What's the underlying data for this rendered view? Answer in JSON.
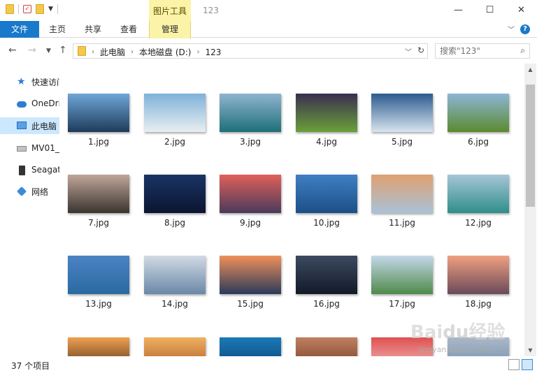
{
  "window": {
    "title": "123",
    "contextual_tab_group": "图片工具",
    "minimize_icon": "minimize-icon",
    "maximize_icon": "maximize-icon",
    "close_icon": "close-icon"
  },
  "ribbon": {
    "tabs": [
      "文件",
      "主页",
      "共享",
      "查看",
      "管理"
    ]
  },
  "address": {
    "crumbs": [
      "此电脑",
      "本地磁盘 (D:)",
      "123"
    ]
  },
  "search": {
    "placeholder": "搜索\"123\""
  },
  "nav": {
    "items": [
      {
        "label": "快速访问",
        "icon": "star-icon"
      },
      {
        "label": "OneDrive",
        "icon": "onedrive-icon"
      },
      {
        "label": "此电脑",
        "icon": "this-pc-icon",
        "selected": true
      },
      {
        "label": "MV01_",
        "icon": "drive-icon"
      },
      {
        "label": "Seagate",
        "icon": "seagate-drive-icon"
      },
      {
        "label": "网络",
        "icon": "network-icon"
      }
    ]
  },
  "files": [
    {
      "name": "1.jpg",
      "c1": "#6fa6d8",
      "c2": "#1e3b5a"
    },
    {
      "name": "2.jpg",
      "c1": "#7eb2d8",
      "c2": "#e8eef2"
    },
    {
      "name": "3.jpg",
      "c1": "#8fb4cf",
      "c2": "#1f6f7a"
    },
    {
      "name": "4.jpg",
      "c1": "#3a2f4f",
      "c2": "#6aa03a"
    },
    {
      "name": "5.jpg",
      "c1": "#2c5b8f",
      "c2": "#d7e4ee"
    },
    {
      "name": "6.jpg",
      "c1": "#8db5d6",
      "c2": "#5b8a2f"
    },
    {
      "name": "7.jpg",
      "c1": "#c0a59a",
      "c2": "#3a3530"
    },
    {
      "name": "8.jpg",
      "c1": "#1a3465",
      "c2": "#0b1530"
    },
    {
      "name": "9.jpg",
      "c1": "#e0605a",
      "c2": "#4a3a5a"
    },
    {
      "name": "10.jpg",
      "c1": "#3f7fc4",
      "c2": "#1c4f86"
    },
    {
      "name": "11.jpg",
      "c1": "#e0a070",
      "c2": "#a8c2d8"
    },
    {
      "name": "12.jpg",
      "c1": "#a6c6d8",
      "c2": "#2f8e8a"
    },
    {
      "name": "13.jpg",
      "c1": "#4b82c3",
      "c2": "#2a6aa2"
    },
    {
      "name": "14.jpg",
      "c1": "#d2dae5",
      "c2": "#6a88a8"
    },
    {
      "name": "15.jpg",
      "c1": "#f0905a",
      "c2": "#2a3a5a"
    },
    {
      "name": "16.jpg",
      "c1": "#3c4a60",
      "c2": "#121a28"
    },
    {
      "name": "17.jpg",
      "c1": "#c5d8ea",
      "c2": "#4f8a4a"
    },
    {
      "name": "18.jpg",
      "c1": "#f0a080",
      "c2": "#6a4a5a"
    },
    {
      "name": "",
      "c1": "#f0a050",
      "c2": "#3a2010"
    },
    {
      "name": "",
      "c1": "#f0b060",
      "c2": "#a05020"
    },
    {
      "name": "",
      "c1": "#1a7ab8",
      "c2": "#0a3a6a"
    },
    {
      "name": "",
      "c1": "#c08060",
      "c2": "#6a3020"
    },
    {
      "name": "",
      "c1": "#e05050",
      "c2": "#f0d0d0"
    },
    {
      "name": "",
      "c1": "#aab8c8",
      "c2": "#6a8aa8"
    }
  ],
  "status": {
    "item_count": "37 个项目"
  },
  "watermark": {
    "text": "Baidu经验",
    "url": "jingyan.baidu.com"
  }
}
